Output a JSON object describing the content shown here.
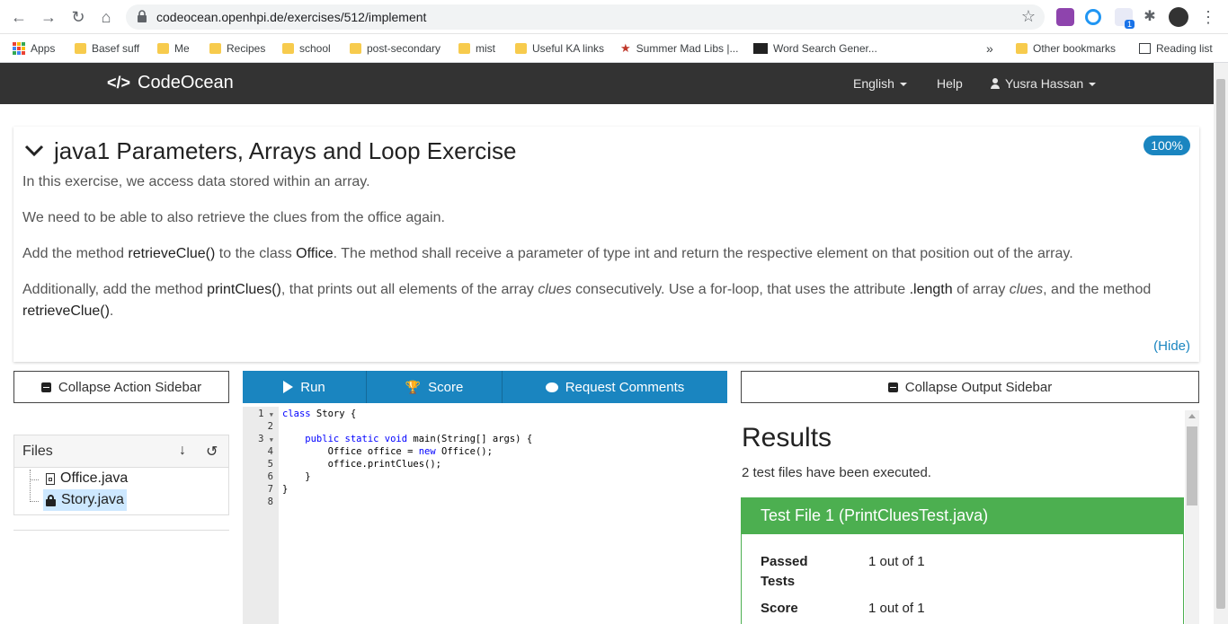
{
  "browser": {
    "url": "codeocean.openhpi.de/exercises/512/implement",
    "bookmarks": [
      "Apps",
      "Basef suff",
      "Me",
      "Recipes",
      "school",
      "post-secondary",
      "mist",
      "Useful KA links",
      "Summer Mad Libs |...",
      "Word Search Gener..."
    ],
    "more": "»",
    "other_bookmarks": "Other bookmarks",
    "reading_list": "Reading list",
    "ext_badge": "1"
  },
  "navbar": {
    "brand_code": "</>",
    "brand": "CodeOcean",
    "language": "English",
    "help": "Help",
    "user": "Yusra Hassan"
  },
  "exercise": {
    "title": "java1 Parameters, Arrays and Loop Exercise",
    "score_badge": "100%",
    "p1": "In this exercise, we access data stored within an array.",
    "p2": "We need to be able to also retrieve the clues from the office again.",
    "p3_a": "Add the method ",
    "p3_b": "retrieveClue()",
    "p3_c": " to the class ",
    "p3_d": "Office",
    "p3_e": ". The method shall receive a parameter of type int and return the respective element on that position out of the array.",
    "p4_a": "Additionally, add the method ",
    "p4_b": "printClues()",
    "p4_c": ", that prints out all elements of the array ",
    "p4_d": "clues",
    "p4_e": " consecutively. Use a for-loop, that uses the attribute ",
    "p4_f": ".length",
    "p4_g": " of array ",
    "p4_h": "clues",
    "p4_i": ", and the method",
    "p4_j": "retrieveClue()",
    "p4_k": ".",
    "hide": "(Hide)"
  },
  "sidebar": {
    "collapse_action": "Collapse Action Sidebar",
    "files_label": "Files",
    "files": [
      "Office.java",
      "Story.java"
    ]
  },
  "toolbar": {
    "run": "Run",
    "score": "Score",
    "request_comments": "Request Comments"
  },
  "editor": {
    "line_numbers": [
      "1",
      "2",
      "3",
      "4",
      "5",
      "6",
      "7",
      "8"
    ],
    "lines": [
      {
        "kw": "class",
        "text": " Story {"
      },
      {
        "kw": "",
        "text": ""
      },
      {
        "kw": "    public static void",
        "text": " main(String[] args) {"
      },
      {
        "kw": "",
        "text": "        Office office = "
      },
      {
        "kw": "",
        "text": "        office.printClues();"
      },
      {
        "kw": "",
        "text": "    }"
      },
      {
        "kw": "",
        "text": "}"
      },
      {
        "kw": "",
        "text": ""
      }
    ],
    "line4_new": "new",
    "line4_tail": " Office();"
  },
  "output": {
    "collapse_output": "Collapse Output Sidebar",
    "results_title": "Results",
    "results_sub": "2 test files have been executed.",
    "test_file_title": "Test File 1 (PrintCluesTest.java)",
    "passed_label_1": "Passed",
    "passed_label_2": "Tests",
    "passed_value": "1 out of 1",
    "score_label": "Score",
    "score_value": "1 out of 1"
  },
  "colors": {
    "accent": "#1a85c0",
    "success": "#4caf50",
    "navbar": "#333333"
  }
}
